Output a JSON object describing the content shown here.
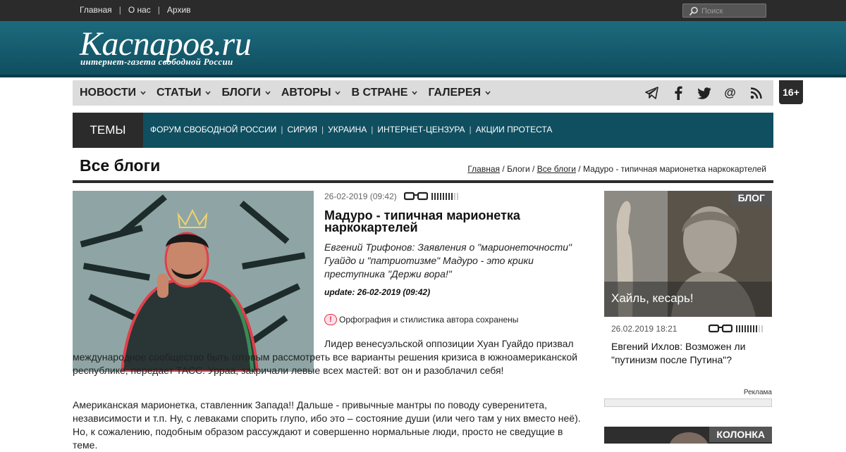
{
  "topbar": {
    "links": [
      "Главная",
      "О нас",
      "Архив"
    ],
    "search_placeholder": "Поиск"
  },
  "masthead": {
    "logo": "Каспаров.ru",
    "tagline": "интернет-газета свободной России"
  },
  "nav": {
    "items": [
      "НОВОСТИ",
      "СТАТЬИ",
      "БЛОГИ",
      "АВТОРЫ",
      "В СТРАНЕ",
      "ГАЛЕРЕЯ"
    ],
    "age_badge": "16+"
  },
  "themes": {
    "label": "ТЕМЫ",
    "links": [
      "ФОРУМ СВОБОДНОЙ РОССИИ",
      "СИРИЯ",
      "УКРАИНА",
      "ИНТЕРНЕТ-ЦЕНЗУРА",
      "АКЦИИ ПРОТЕСТА"
    ]
  },
  "page": {
    "title": "Все блоги",
    "breadcrumb": {
      "home": "Главная",
      "sep1": " / ",
      "blogs": "Блоги",
      "sep2": " / ",
      "all": "Все блоги",
      "sep3": " / ",
      "current": "Мадуро - типичная марионетка наркокартелей"
    }
  },
  "article": {
    "date": "26-02-2019 (09:42)",
    "title": "Мадуро - типичная марионетка наркокартелей",
    "lead": "Евгений Трифонов: Заявления о \"марионеточности\" Гуайдо и \"патриотизме\" Мадуро - это крики преступника \"Держи вора!\"",
    "update": "update: 26-02-2019 (09:42)",
    "spelling_note": "Орфография и стилистика автора сохранены",
    "paragraph1": "Лидер венесуэльской оппозиции Хуан Гуайдо призвал международное сообщество быть готовым рассмотреть все варианты решения кризиса в южноамериканской республике, передает ТАСС. Урраа, закричали левые всех мастей: вот он и разоблачил себя!",
    "paragraph2": "Американская марионетка, ставленник Запада!! Дальше - привычные мантры по поводу суверенитета, независимости и т.п. Ну, с леваками спорить глупо, ибо это – состояние души (или чего там у них вместо неё). Но, к сожалению, подобным образом рассуждают и совершенно нормальные люди, просто не сведущие в теме."
  },
  "sidebar": {
    "card_tag": "БЛОГ",
    "card_caption": "Хайль, кесарь!",
    "card_date": "26.02.2019 18:21",
    "card_title": "Евгений Ихлов: Возможен ли \"путинизм после Путина\"?",
    "ad_label": "Реклама",
    "column_tag": "КОЛОНКА"
  },
  "colors": {
    "topbar": "#2b2b2b",
    "masthead": "#0f4f60",
    "navbar": "#dcdcdc",
    "accent_red": "#d33333"
  }
}
